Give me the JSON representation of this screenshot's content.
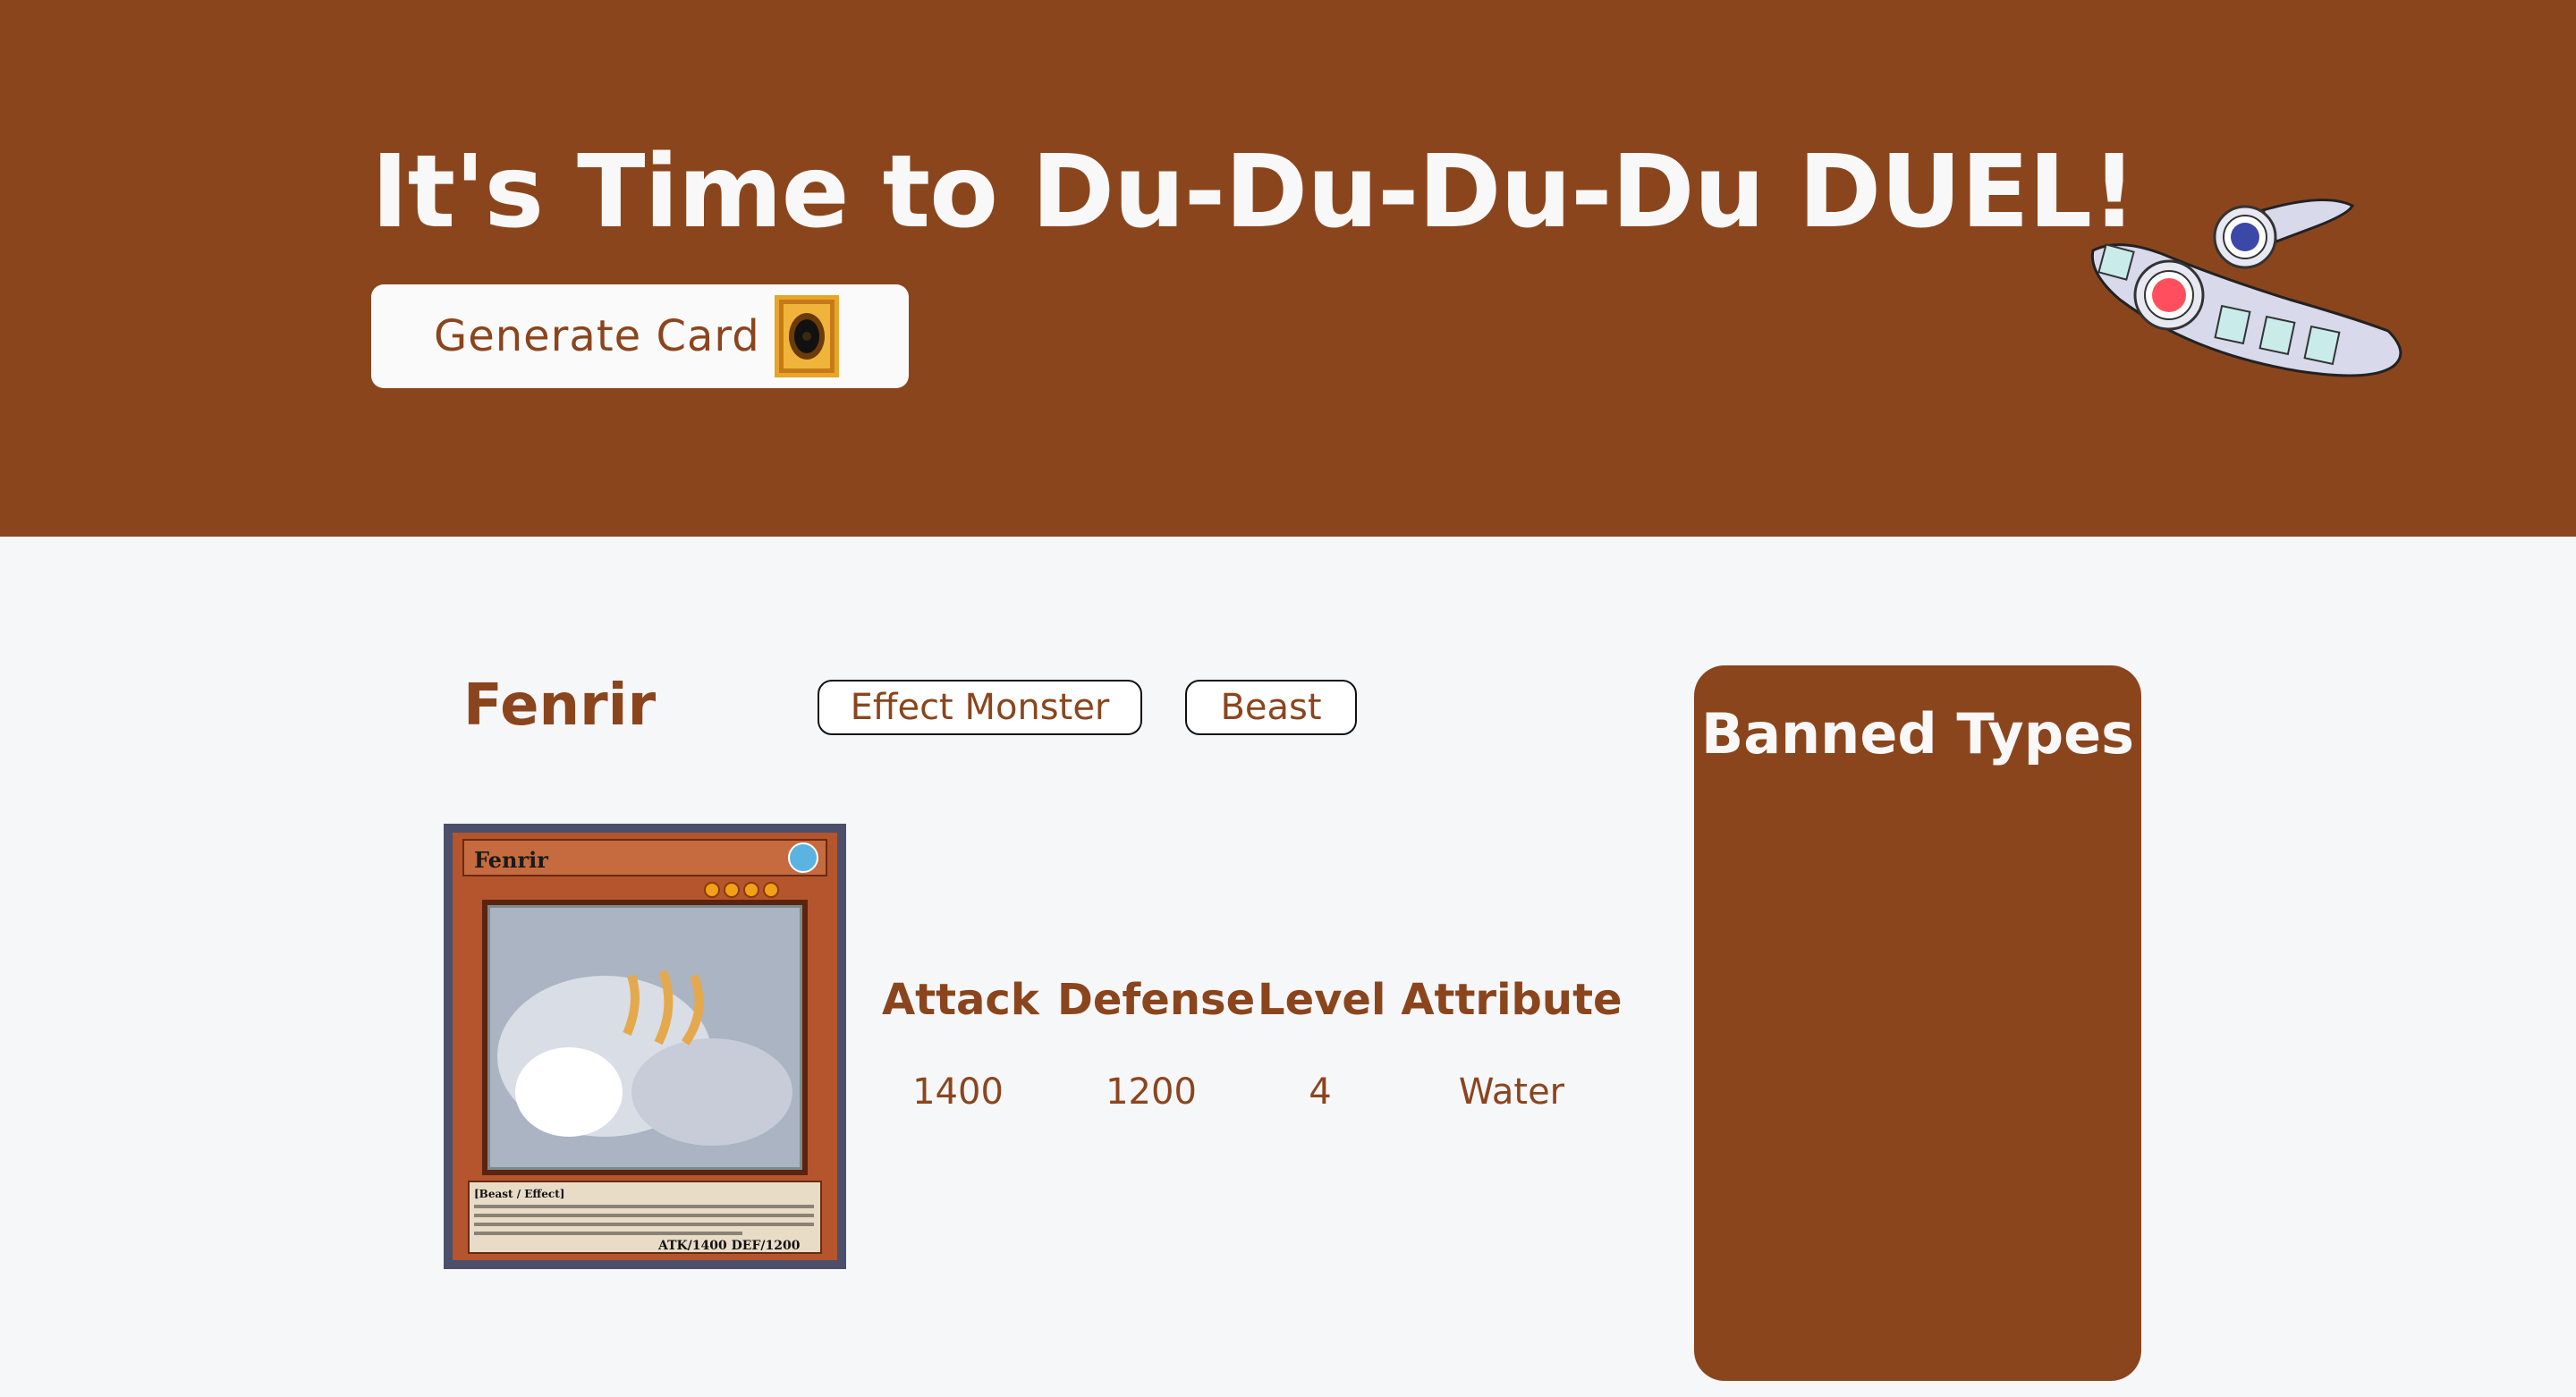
{
  "header": {
    "title": "It's Time to Du-Du-Du-Du DUEL!",
    "generate_button_label": "Generate Card",
    "icons": [
      "card-back-icon",
      "duel-disk-icon"
    ]
  },
  "card": {
    "name": "Fenrir",
    "type": "Effect Monster",
    "race": "Beast",
    "image_text": {
      "name": "Fenrir",
      "type_line": "[Beast / Effect]",
      "stats_line": "ATK/1400  DEF/1200"
    },
    "stats": [
      {
        "label": "Attack",
        "value": "1400"
      },
      {
        "label": "Defense",
        "value": "1200"
      },
      {
        "label": "Level",
        "value": "4"
      },
      {
        "label": "Attribute",
        "value": "Water"
      }
    ]
  },
  "banned": {
    "title": "Banned Types"
  },
  "colors": {
    "brand": "#8b451d",
    "background": "#f6f7f9",
    "button": "#fafafa"
  }
}
